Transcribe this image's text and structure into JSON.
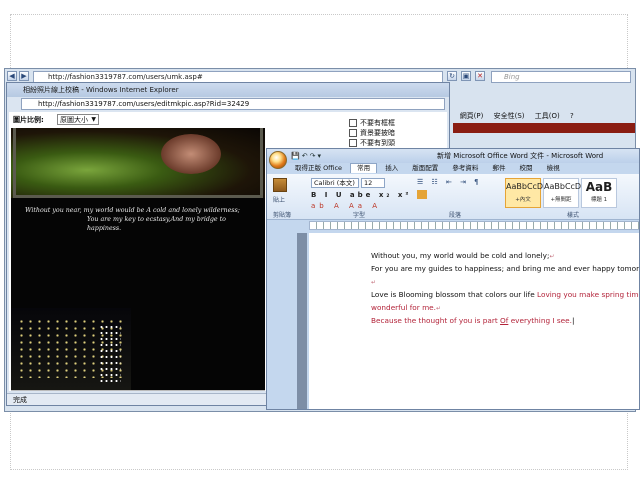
{
  "ie_back": {
    "address": "http://fashion3319787.com/users/umk.asp#",
    "search_placeholder": "Bing",
    "toolbar": [
      "網頁(P)",
      "安全性(S)",
      "工具(O)"
    ]
  },
  "ie_front": {
    "title": "相紛照片線上校稿 - Windows Internet Explorer",
    "address": "http://fashion3319787.com/users/editmkpic.asp?Rid=32429",
    "ratio_label": "圖片比例:",
    "ratio_value": "原圖大小",
    "options": [
      "不要有框框",
      "資景要披暗",
      "不要有到頭"
    ],
    "poem_line1": "Without you near, my world would be  A cold and lonely wilderness;",
    "poem_line2": "You are my key to ecstasy,And my bridge to happiness.",
    "status": "完成"
  },
  "word": {
    "title": "新增 Microsoft Office Word 文件 - Microsoft Word",
    "tabs": [
      "取得正版 Office",
      "常用",
      "插入",
      "版面配置",
      "參考資料",
      "郵件",
      "校閱",
      "檢視"
    ],
    "active_tab": "常用",
    "font_name": "Calibri (本文)",
    "font_size": "12",
    "paste_label": "貼上",
    "groups": [
      "剪貼簿",
      "字型",
      "段落",
      "樣式"
    ],
    "styles": [
      {
        "sample": "AaBbCcD",
        "name": "+內文"
      },
      {
        "sample": "AaBbCcD",
        "name": "+無間距"
      },
      {
        "sample": "AaB",
        "name": "標題 1"
      }
    ],
    "doc_lines": [
      "Without you, my world would be cold and lonely;",
      "For you are my guides to happiness;  and bring me and ever happy tomorrow.",
      "Love is Blooming blossom that colors our life",
      "Loving you make spring time still more",
      "wonderful for me.",
      "Because the thought of you is part",
      "Of",
      "everything I see."
    ]
  }
}
